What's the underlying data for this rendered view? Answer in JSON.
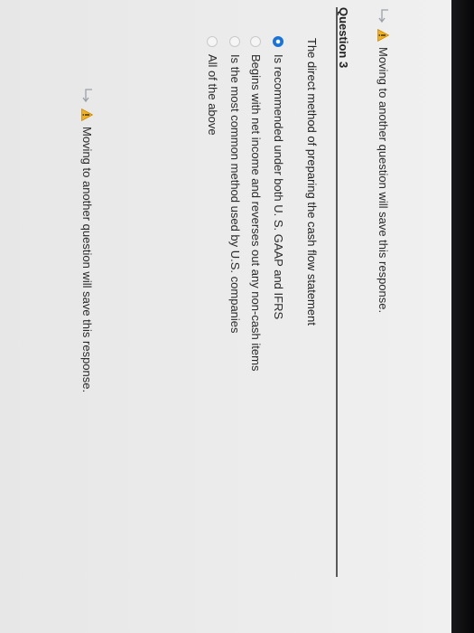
{
  "notices": {
    "top": "Moving to another question will save this response.",
    "bottom": "Moving to another question will save this response."
  },
  "question": {
    "title": "Question 3",
    "stem": "The direct method of preparing the cash flow statement",
    "choices": [
      {
        "label": "Is recommended under both U. S. GAAP and IFRS",
        "selected": true
      },
      {
        "label": "Begins with net income and reverses out any non-cash items",
        "selected": false
      },
      {
        "label": "Is the most common method used by U.S. companies",
        "selected": false
      },
      {
        "label": "All of the above",
        "selected": false
      }
    ]
  },
  "icons": {
    "arrow": "return-arrow-icon",
    "warning": "warning-icon"
  },
  "colors": {
    "selected_radio": "#1a73d8",
    "warning_fill": "#f2b01e",
    "divider": "#5a5a5a"
  }
}
